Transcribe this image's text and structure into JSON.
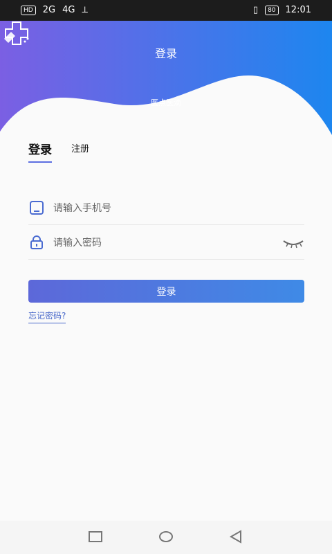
{
  "status_bar": {
    "left": {
      "hd": "HD",
      "sim1": "2G",
      "sim2": "4G"
    },
    "right": {
      "battery": "80",
      "time": "12:01"
    }
  },
  "header": {
    "title": "登录",
    "app_name": "医点医滴"
  },
  "tabs": [
    {
      "label": "登录"
    },
    {
      "label": "注册"
    }
  ],
  "form": {
    "phone": {
      "placeholder": "请输入手机号"
    },
    "password": {
      "placeholder": "请输入密码"
    },
    "login_button": "登录",
    "forgot_password": "忘记密码?"
  },
  "colors": {
    "header_gradient_start": "#7b5fe3",
    "header_gradient_end": "#1d86ef",
    "primary": "#5b6ee1",
    "link": "#4666c9"
  },
  "icons": {
    "logo": "doctor-logo",
    "phone": "phone-icon",
    "lock": "lock-icon",
    "eye_closed": "eye-closed-icon",
    "nav_recent": "square-icon",
    "nav_home": "circle-icon",
    "nav_back": "triangle-back-icon"
  }
}
